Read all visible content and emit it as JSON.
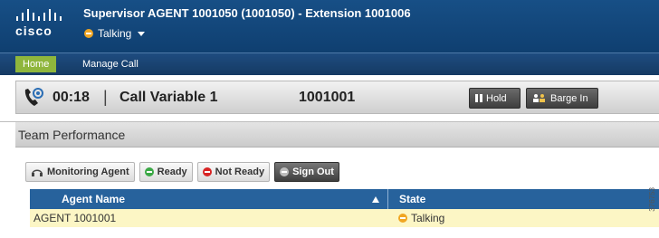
{
  "header": {
    "logo_text": "cisco",
    "title": "Supervisor AGENT 1001050 (1001050) - Extension 1001006",
    "status": {
      "label": "Talking",
      "icon": "talking-status-icon",
      "color": "#f0a623"
    }
  },
  "nav": {
    "home_label": "Home",
    "manage_call_label": "Manage Call"
  },
  "call": {
    "duration": "00:18",
    "separator": "|",
    "variable": "Call Variable 1",
    "number": "1001001",
    "hold_label": "Hold",
    "barge_label": "Barge In"
  },
  "panel": {
    "title": "Team Performance",
    "toolbar": {
      "monitoring_label": "Monitoring Agent",
      "ready_label": "Ready",
      "not_ready_label": "Not Ready",
      "sign_out_label": "Sign Out"
    },
    "table": {
      "columns": [
        "Agent Name",
        "State"
      ],
      "rows": [
        {
          "agent": "AGENT 1001001",
          "state": "Talking"
        }
      ]
    }
  },
  "figure_id": "376753",
  "colors": {
    "header": "#174f86",
    "home_tab": "#8fb63c",
    "grid_header": "#27629c",
    "row_highlight": "#fcf6c5"
  }
}
